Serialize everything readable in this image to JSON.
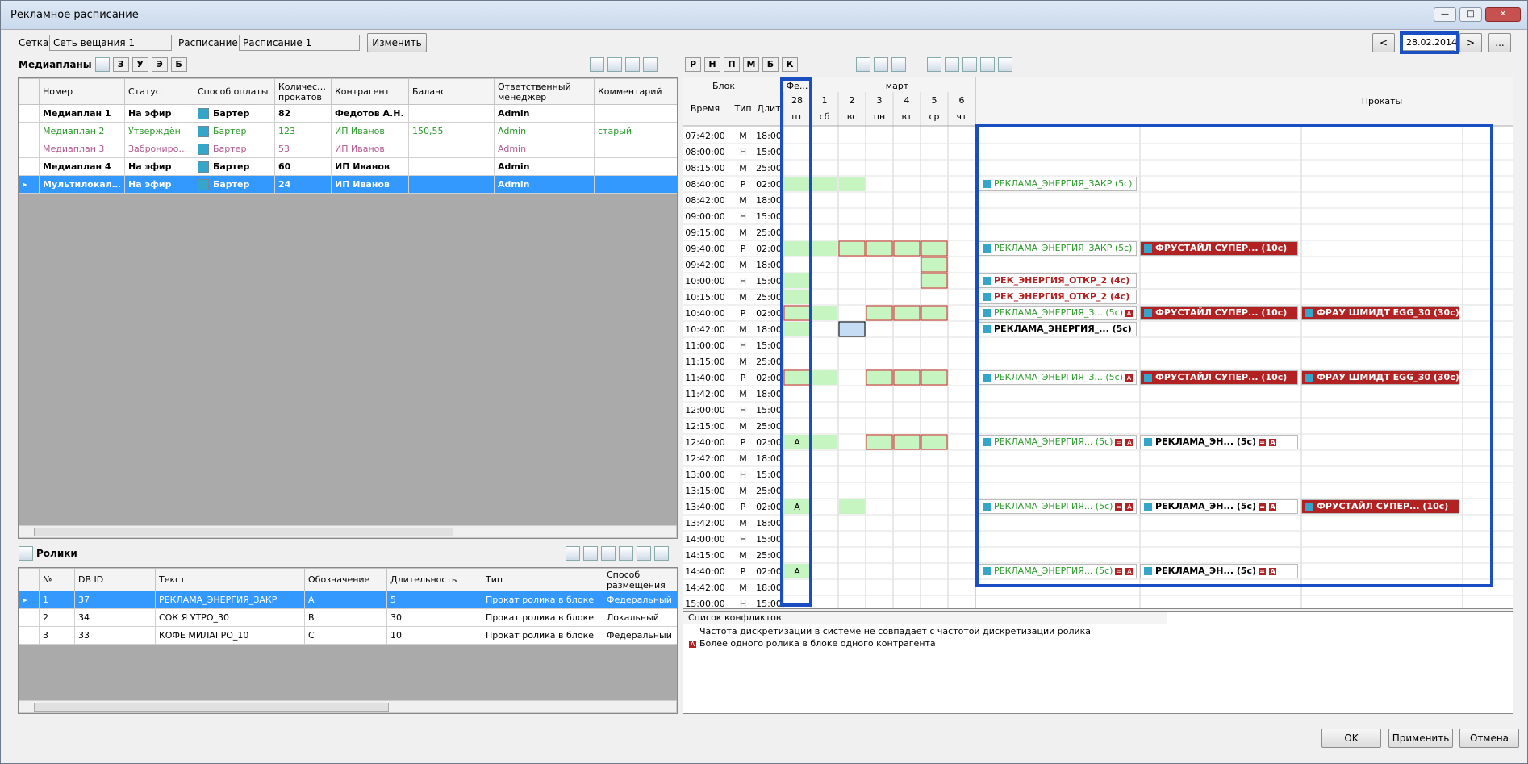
{
  "window": {
    "title": "Рекламное расписание"
  },
  "top": {
    "grid_label": "Сетка:",
    "grid_value": "Сеть вещания 1",
    "schedule_label": "Расписание:",
    "schedule_value": "Расписание 1",
    "change_btn": "Изменить"
  },
  "date_nav": {
    "prev": "<",
    "date": "28.02.2014",
    "next": ">",
    "more": "..."
  },
  "mediaplans": {
    "title": "Медиапланы",
    "filters": [
      "З",
      "У",
      "Э",
      "Б"
    ],
    "headers": [
      "Номер",
      "Статус",
      "Способ оплаты",
      "Количество прокатов",
      "Контрагент",
      "Баланс",
      "Ответственный менеджер",
      "Комментарий"
    ],
    "rows": [
      {
        "num": "Медиаплан 1",
        "status": "На эфир",
        "pay": "Бартер",
        "count": "82",
        "agent": "Федотов А.Н.",
        "balance": "",
        "manager": "Admin",
        "comment": "",
        "style": "bold"
      },
      {
        "num": "Медиаплан 2",
        "status": "Утверждён",
        "pay": "Бартер",
        "count": "123",
        "agent": "ИП Иванов",
        "balance": "150,55",
        "manager": "Admin",
        "comment": "старый",
        "style": "green"
      },
      {
        "num": "Медиаплан 3",
        "status": "Забронирован",
        "pay": "Бартер",
        "count": "53",
        "agent": "ИП Иванов",
        "balance": "",
        "manager": "Admin",
        "comment": "",
        "style": "pink"
      },
      {
        "num": "Медиаплан 4",
        "status": "На эфир",
        "pay": "Бартер",
        "count": "60",
        "agent": "ИП Иванов",
        "balance": "",
        "manager": "Admin",
        "comment": "",
        "style": "bold"
      },
      {
        "num": "Мультилокаль...",
        "status": "На эфир",
        "pay": "Бартер",
        "count": "24",
        "agent": "ИП Иванов",
        "balance": "",
        "manager": "Admin",
        "comment": "",
        "style": "sel"
      }
    ]
  },
  "clips": {
    "title": "Ролики",
    "headers": [
      "№",
      "DB ID",
      "Текст",
      "Обозначение",
      "Длительность",
      "Тип",
      "Способ размещения"
    ],
    "rows": [
      {
        "n": "1",
        "id": "37",
        "text": "РЕКЛАМА_ЭНЕРГИЯ_ЗАКР",
        "mark": "A",
        "dur": "5",
        "type": "Прокат ролика в блоке",
        "place": "Федеральный"
      },
      {
        "n": "2",
        "id": "34",
        "text": "СОК Я УТРО_30",
        "mark": "B",
        "dur": "30",
        "type": "Прокат ролика в блоке",
        "place": "Локальный"
      },
      {
        "n": "3",
        "id": "33",
        "text": "КОФЕ МИЛАГРО_10",
        "mark": "C",
        "dur": "10",
        "type": "Прокат ролика в блоке",
        "place": "Федеральный"
      }
    ]
  },
  "sched_toolbar": [
    "Р",
    "Н",
    "П",
    "М",
    "Б",
    "К"
  ],
  "sched": {
    "block_label": "Блок",
    "time_label": "Время",
    "type_label": "Тип",
    "dur_label": "Длит",
    "month_fe": "Фе...",
    "month_mar": "март",
    "rentals_label": "Прокаты",
    "days": [
      {
        "d": "28",
        "w": "пт"
      },
      {
        "d": "1",
        "w": "сб"
      },
      {
        "d": "2",
        "w": "вс"
      },
      {
        "d": "3",
        "w": "пн"
      },
      {
        "d": "4",
        "w": "вт"
      },
      {
        "d": "5",
        "w": "ср"
      },
      {
        "d": "6",
        "w": "чт"
      }
    ],
    "rows": [
      {
        "t": "07:42:00",
        "ty": "М",
        "d": "18:00"
      },
      {
        "t": "08:00:00",
        "ty": "Н",
        "d": "15:00"
      },
      {
        "t": "08:15:00",
        "ty": "М",
        "d": "25:00"
      },
      {
        "t": "08:40:00",
        "ty": "Р",
        "d": "02:00"
      },
      {
        "t": "08:42:00",
        "ty": "М",
        "d": "18:00"
      },
      {
        "t": "09:00:00",
        "ty": "Н",
        "d": "15:00"
      },
      {
        "t": "09:15:00",
        "ty": "М",
        "d": "25:00"
      },
      {
        "t": "09:40:00",
        "ty": "Р",
        "d": "02:00"
      },
      {
        "t": "09:42:00",
        "ty": "М",
        "d": "18:00"
      },
      {
        "t": "10:00:00",
        "ty": "Н",
        "d": "15:00"
      },
      {
        "t": "10:15:00",
        "ty": "М",
        "d": "25:00"
      },
      {
        "t": "10:40:00",
        "ty": "Р",
        "d": "02:00"
      },
      {
        "t": "10:42:00",
        "ty": "М",
        "d": "18:00"
      },
      {
        "t": "11:00:00",
        "ty": "Н",
        "d": "15:00"
      },
      {
        "t": "11:15:00",
        "ty": "М",
        "d": "25:00"
      },
      {
        "t": "11:40:00",
        "ty": "Р",
        "d": "02:00"
      },
      {
        "t": "11:42:00",
        "ty": "М",
        "d": "18:00"
      },
      {
        "t": "12:00:00",
        "ty": "Н",
        "d": "15:00"
      },
      {
        "t": "12:15:00",
        "ty": "М",
        "d": "25:00"
      },
      {
        "t": "12:40:00",
        "ty": "Р",
        "d": "02:00"
      },
      {
        "t": "12:42:00",
        "ty": "М",
        "d": "18:00"
      },
      {
        "t": "13:00:00",
        "ty": "Н",
        "d": "15:00"
      },
      {
        "t": "13:15:00",
        "ty": "М",
        "d": "25:00"
      },
      {
        "t": "13:40:00",
        "ty": "Р",
        "d": "02:00"
      },
      {
        "t": "13:42:00",
        "ty": "М",
        "d": "18:00"
      },
      {
        "t": "14:00:00",
        "ty": "Н",
        "d": "15:00"
      },
      {
        "t": "14:15:00",
        "ty": "М",
        "d": "25:00"
      },
      {
        "t": "14:40:00",
        "ty": "Р",
        "d": "02:00"
      },
      {
        "t": "14:42:00",
        "ty": "М",
        "d": "18:00"
      },
      {
        "t": "15:00:00",
        "ty": "Н",
        "d": "15:00"
      }
    ],
    "cell_a": "A",
    "ads": [
      {
        "text": "РЕКЛАМА_ЭНЕРГИЯ_ЗАКР (5с)"
      },
      {
        "text": "РЕКЛАМА_ЭНЕРГИЯ_ЗАКР (5с)"
      },
      {
        "text": "ФРУСТАЙЛ СУПЕР... (10с)"
      },
      {
        "text": "РЕК_ЭНЕРГИЯ_ОТКР_2 (4с)"
      },
      {
        "text": "РЕК_ЭНЕРГИЯ_ОТКР_2 (4с)"
      },
      {
        "text": "РЕКЛАМА_ЭНЕРГИЯ_З... (5с)"
      },
      {
        "text": "ФРУСТАЙЛ СУПЕР... (10с)"
      },
      {
        "text": "ФРАУ ШМИДТ EGG_30 (30с)"
      },
      {
        "text": "РЕКЛАМА_ЭНЕРГИЯ_... (5с)"
      },
      {
        "text": "РЕКЛАМА_ЭНЕРГИЯ_З... (5с)"
      },
      {
        "text": "ФРУСТАЙЛ СУПЕР... (10с)"
      },
      {
        "text": "ФРАУ ШМИДТ EGG_30 (30с)"
      },
      {
        "text": "РЕКЛАМА_ЭНЕРГИЯ... (5с)"
      },
      {
        "text": "РЕКЛАМА_ЭН... (5с)"
      },
      {
        "text": "РЕКЛАМА_ЭНЕРГИЯ... (5с)"
      },
      {
        "text": "РЕКЛАМА_ЭН... (5с)"
      },
      {
        "text": "ФРУСТАЙЛ СУПЕР... (10с)"
      },
      {
        "text": "РЕКЛАМА_ЭНЕРГИЯ... (5с)"
      },
      {
        "text": "РЕКЛАМА_ЭН... (5с)"
      }
    ],
    "marks": {
      "a": "A",
      "eq": "="
    }
  },
  "conflicts": {
    "title": "Список конфликтов",
    "items": [
      "Частота дискретизации в системе не совпадает с частотой дискретизации ролика",
      "Более одного ролика в блоке одного контрагента"
    ]
  },
  "footer": {
    "ok": "OK",
    "apply": "Применить",
    "cancel": "Отмена"
  }
}
